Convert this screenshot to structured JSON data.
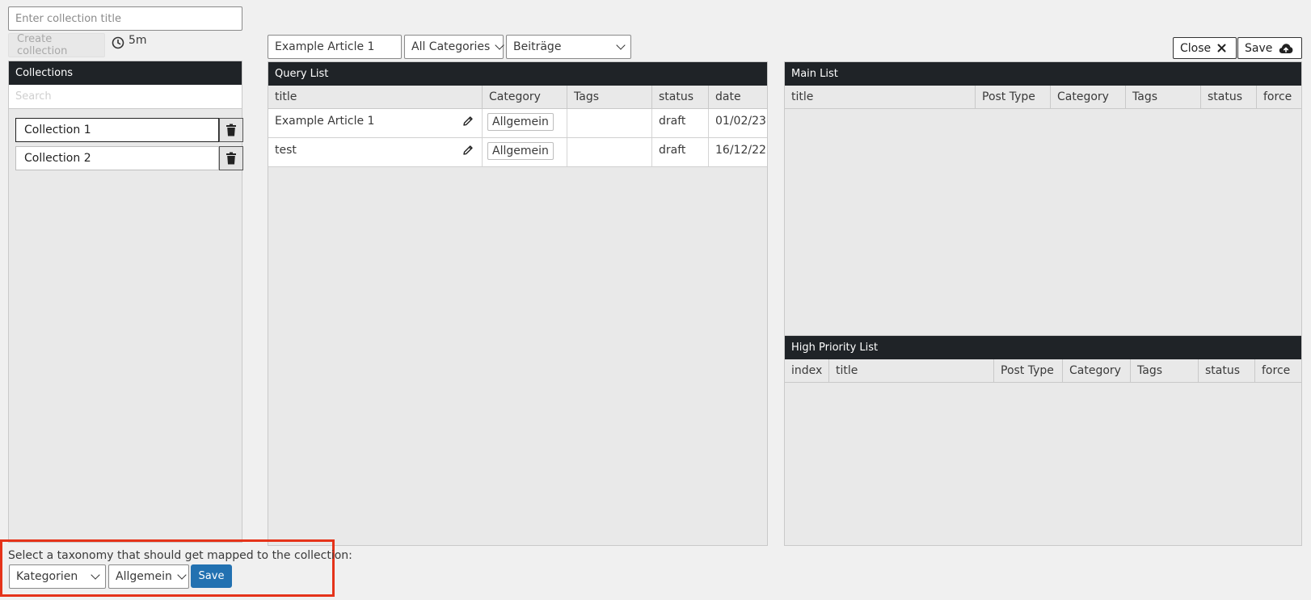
{
  "top_left": {
    "title_placeholder": "Enter collection title",
    "create_button": "Create collection",
    "timer_text": "5m"
  },
  "collections": {
    "header": "Collections",
    "search_placeholder": "Search",
    "items": [
      {
        "label": "Collection 1",
        "active": true
      },
      {
        "label": "Collection 2",
        "active": false
      }
    ]
  },
  "query_filters": {
    "search_value": "Example Article 1",
    "category_select": "All Categories",
    "post_type_select": "Beiträge"
  },
  "query_list": {
    "header": "Query List",
    "columns": [
      "title",
      "Category",
      "Tags",
      "status",
      "date"
    ],
    "rows": [
      {
        "title": "Example Article 1",
        "category": "Allgemein",
        "tags": "",
        "status": "draft",
        "date": "01/02/23"
      },
      {
        "title": "test",
        "category": "Allgemein",
        "tags": "",
        "status": "draft",
        "date": "16/12/22"
      }
    ]
  },
  "top_right": {
    "close_label": "Close",
    "save_label": "Save"
  },
  "main_list": {
    "header": "Main List",
    "columns": [
      "title",
      "Post Type",
      "Category",
      "Tags",
      "status",
      "force"
    ]
  },
  "high_priority_list": {
    "header": "High Priority List",
    "columns": [
      "index",
      "title",
      "Post Type",
      "Category",
      "Tags",
      "status",
      "force"
    ]
  },
  "taxonomy": {
    "prompt": "Select a taxonomy that should get mapped to the collection:",
    "taxonomy_select": "Kategorien",
    "term_select": "Allgemein",
    "save_label": "Save"
  },
  "colors": {
    "header_bg": "#1f2327",
    "primary": "#2271b1",
    "highlight": "#e5331a",
    "panel_bg": "#e9e9e9"
  }
}
